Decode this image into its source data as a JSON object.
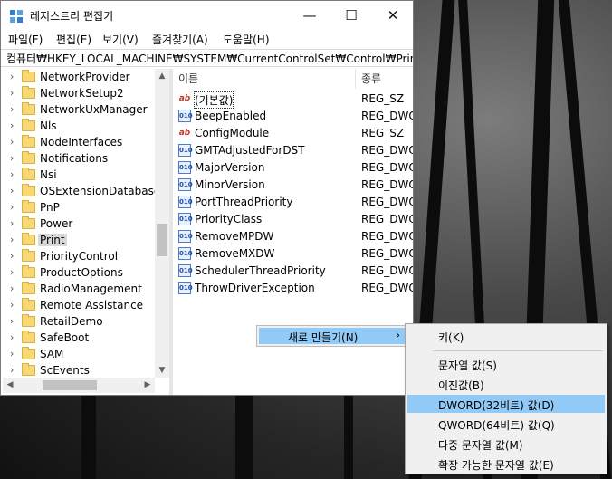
{
  "window": {
    "title": "레지스트리 편집기",
    "controls": {
      "minimize": "—",
      "maximize": "☐",
      "close": "✕"
    }
  },
  "menubar": [
    {
      "label": "파일(F)"
    },
    {
      "label": "편집(E)"
    },
    {
      "label": "보기(V)"
    },
    {
      "label": "즐겨찾기(A)"
    },
    {
      "label": "도움말(H)"
    }
  ],
  "address": "컴퓨터₩HKEY_LOCAL_MACHINE₩SYSTEM₩CurrentControlSet₩Control₩Print",
  "tree": {
    "items": [
      {
        "label": "NetworkProvider"
      },
      {
        "label": "NetworkSetup2"
      },
      {
        "label": "NetworkUxManager"
      },
      {
        "label": "Nls"
      },
      {
        "label": "NodeInterfaces"
      },
      {
        "label": "Notifications"
      },
      {
        "label": "Nsi"
      },
      {
        "label": "OSExtensionDatabase"
      },
      {
        "label": "PnP"
      },
      {
        "label": "Power"
      },
      {
        "label": "Print",
        "selected": true
      },
      {
        "label": "PriorityControl"
      },
      {
        "label": "ProductOptions"
      },
      {
        "label": "RadioManagement"
      },
      {
        "label": "Remote Assistance"
      },
      {
        "label": "RetailDemo"
      },
      {
        "label": "SafeBoot"
      },
      {
        "label": "SAM"
      },
      {
        "label": "ScEvents"
      }
    ]
  },
  "values_list": {
    "headers": {
      "name": "이름",
      "type": "종류"
    },
    "rows": [
      {
        "icon": "string-value-icon",
        "name": "(기본값)",
        "type": "REG_SZ",
        "focused": true
      },
      {
        "icon": "binary-value-icon",
        "name": "BeepEnabled",
        "type": "REG_DWORD"
      },
      {
        "icon": "string-value-icon",
        "name": "ConfigModule",
        "type": "REG_SZ"
      },
      {
        "icon": "binary-value-icon",
        "name": "GMTAdjustedForDST",
        "type": "REG_DWORD"
      },
      {
        "icon": "binary-value-icon",
        "name": "MajorVersion",
        "type": "REG_DWORD"
      },
      {
        "icon": "binary-value-icon",
        "name": "MinorVersion",
        "type": "REG_DWORD"
      },
      {
        "icon": "binary-value-icon",
        "name": "PortThreadPriority",
        "type": "REG_DWORD"
      },
      {
        "icon": "binary-value-icon",
        "name": "PriorityClass",
        "type": "REG_DWORD"
      },
      {
        "icon": "binary-value-icon",
        "name": "RemoveMPDW",
        "type": "REG_DWORD"
      },
      {
        "icon": "binary-value-icon",
        "name": "RemoveMXDW",
        "type": "REG_DWORD"
      },
      {
        "icon": "binary-value-icon",
        "name": "SchedulerThreadPriority",
        "type": "REG_DWORD"
      },
      {
        "icon": "binary-value-icon",
        "name": "ThrowDriverException",
        "type": "REG_DWORD"
      }
    ]
  },
  "context_menu": {
    "new_label": "새로 만들기(N)",
    "arrow": "›"
  },
  "submenu": {
    "items": [
      {
        "label": "키(K)"
      },
      {
        "label": "문자열 값(S)"
      },
      {
        "label": "이진값(B)"
      },
      {
        "label": "DWORD(32비트) 값(D)",
        "highlighted": true
      },
      {
        "label": "QWORD(64비트) 값(Q)"
      },
      {
        "label": "다중 문자열 값(M)"
      },
      {
        "label": "확장 가능한 문자열 값(E)"
      }
    ]
  },
  "colors": {
    "highlight": "#91c9f7",
    "selection_gray": "#d9d9d9",
    "folder": "#f8d775"
  }
}
